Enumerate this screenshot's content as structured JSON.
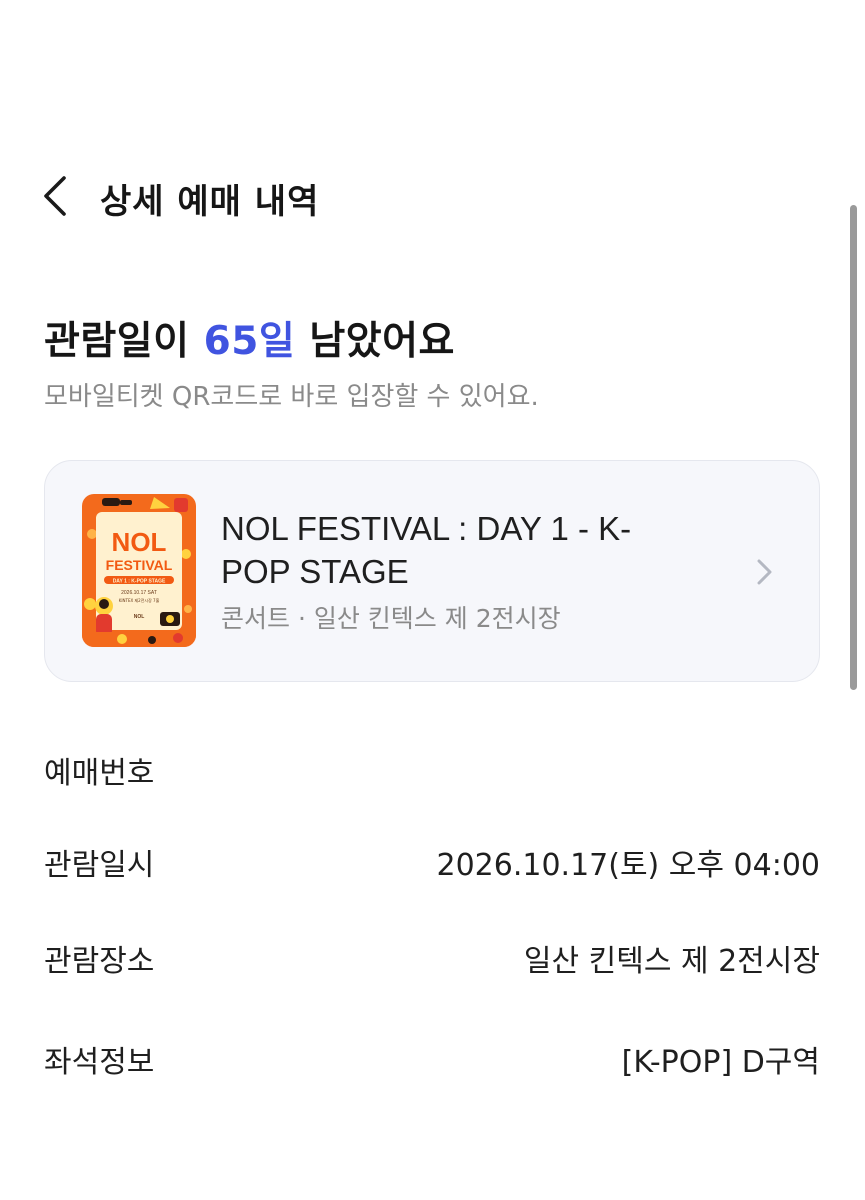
{
  "header": {
    "back_icon": "chevron-left-icon",
    "title": "상세 예매 내역"
  },
  "hero": {
    "dday_prefix": "관람일이 ",
    "dday_value": "65일",
    "dday_suffix": " 남았어요",
    "subtitle": "모바일티켓 QR코드로 바로 입장할 수 있어요.",
    "accent_color": "#4054e0"
  },
  "event": {
    "title": "NOL FESTIVAL : DAY 1 - K-POP STAGE",
    "category": "콘서트",
    "separator": " · ",
    "venue": "일산 킨텍스 제 2전시장",
    "poster": {
      "headline_1": "NOL",
      "headline_2": "FESTIVAL",
      "ribbon": "DAY 1 : K-POP STAGE",
      "date_line": "2026.10.17 SAT",
      "place_line": "KINTEX 제2전시장 7홀",
      "brand": "NOL"
    },
    "chevron_icon": "chevron-right-icon"
  },
  "details": {
    "rows": [
      {
        "label": "예매번호",
        "value": ""
      },
      {
        "label": "관람일시",
        "value": "2026.10.17(토) 오후 04:00"
      },
      {
        "label": "관람장소",
        "value": "일산 킨텍스 제 2전시장"
      },
      {
        "label": "좌석정보",
        "value": "[K-POP] D구역"
      }
    ]
  }
}
